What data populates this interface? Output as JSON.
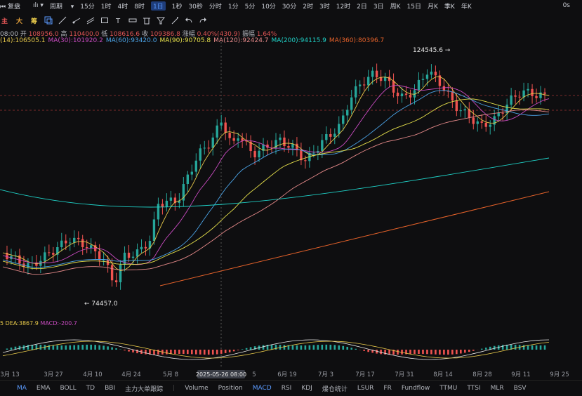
{
  "toolbar": {
    "replay": "复盘",
    "period": "周期",
    "intervals": [
      "15分",
      "1时",
      "4时",
      "8时",
      "1日",
      "1秒",
      "30秒",
      "分时",
      "1分",
      "5分",
      "10分",
      "30分",
      "2时",
      "3时",
      "12时",
      "2日",
      "3日",
      "周K",
      "15日",
      "月K",
      "季K",
      "年K"
    ],
    "active_interval": "1日",
    "right_label": "0s"
  },
  "subtools": {
    "main": "主",
    "large": "大",
    "chips": "筹"
  },
  "ohlc_line": {
    "time": "08:00",
    "open_label": "开",
    "open": "108956.0",
    "high_label": "高",
    "high": "110400.0",
    "low_label": "低",
    "low": "108616.6",
    "close_label": "收",
    "close": "109386.8",
    "change_label": "涨幅",
    "change": "0.40%(430.9)",
    "amp_label": "振幅",
    "amp": "1.64%"
  },
  "ma_line": [
    {
      "label": "(14):106505.1",
      "color": "#e6c84a"
    },
    {
      "label": "MA(30):101920.2",
      "color": "#c94bc1"
    },
    {
      "label": "MA(60):93420.0",
      "color": "#4ba3e6"
    },
    {
      "label": "MA(90):90705.8",
      "color": "#e6e04b"
    },
    {
      "label": "MA(120):92424.7",
      "color": "#e68a8a"
    },
    {
      "label": "MA(200):94115.9",
      "color": "#1fd2c8"
    },
    {
      "label": "MA(360):80396.7",
      "color": "#e6622a"
    }
  ],
  "annotations": {
    "high": "124545.6",
    "low": "74457.0"
  },
  "macd": {
    "dif_label": "5",
    "dea": "DEA:3867.9",
    "macd": "MACD:-200.7"
  },
  "x_ticks": [
    "3月 13",
    "3月 27",
    "4月 10",
    "4月 24",
    "5月 8",
    "5",
    "6月 19",
    "7月 3",
    "7月 17",
    "7月 31",
    "8月 14",
    "8月 28",
    "9月 11",
    "9月 25"
  ],
  "crosshair_label": "2025-05-26 08:00",
  "bottom_tabs": [
    "MA",
    "EMA",
    "BOLL",
    "TD",
    "BBI",
    "主力大单跟踪",
    "Volume",
    "Position",
    "MACD",
    "RSI",
    "KDJ",
    "爆仓统计",
    "LSUR",
    "FR",
    "Fundflow",
    "TTMU",
    "TTSI",
    "MLR",
    "BSV"
  ],
  "active_bottom": [
    "MA",
    "MACD"
  ],
  "colors": {
    "up": "#26a69a",
    "down": "#ef5350",
    "accent": "#5b9bff",
    "bg": "#0e0e10"
  }
}
